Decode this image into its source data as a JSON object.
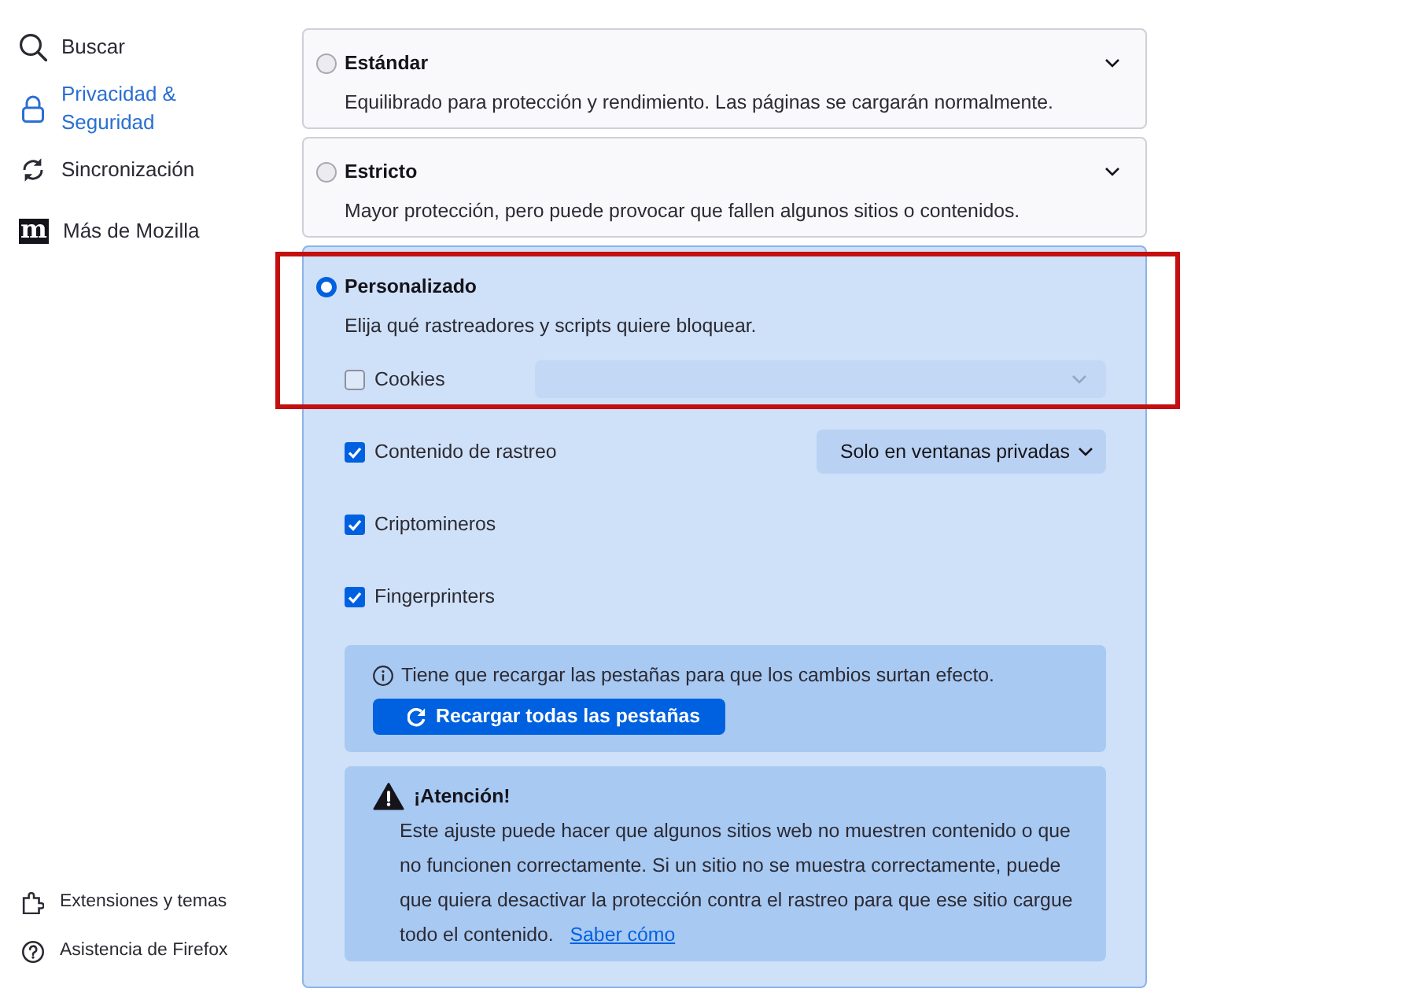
{
  "sidebar": {
    "items": [
      {
        "label": "Buscar",
        "selected": false
      },
      {
        "label": "Privacidad & Seguridad",
        "selected": true
      },
      {
        "label": "Sincronización",
        "selected": false
      },
      {
        "label": "Más de Mozilla",
        "selected": false,
        "logo_glyph": "m"
      }
    ],
    "footer_links": [
      {
        "label": "Extensiones y temas"
      },
      {
        "label": "Asistencia de Firefox"
      }
    ]
  },
  "protection_levels": [
    {
      "label": "Estándar",
      "description": "Equilibrado para protección y rendimiento. Las páginas se cargarán normalmente.",
      "selected": false,
      "expanded": false
    },
    {
      "label": "Estricto",
      "description": "Mayor protección, pero puede provocar que fallen algunos sitios o contenidos.",
      "selected": false,
      "expanded": false
    },
    {
      "label": "Personalizado",
      "description": "Elija qué rastreadores y scripts quiere bloquear.",
      "selected": true,
      "expanded": true,
      "highlighted": true,
      "options": [
        {
          "label": "Cookies",
          "checked": false,
          "dropdown": {
            "disabled": true
          }
        },
        {
          "label": "Contenido de rastreo",
          "checked": true,
          "dropdown": {
            "value": "Solo en ventanas privadas",
            "disabled": false
          }
        },
        {
          "label": "Criptomineros",
          "checked": true
        },
        {
          "label": "Fingerprinters",
          "checked": true
        }
      ],
      "notice": {
        "text": "Tiene que recargar las pestañas para que los cambios surtan efecto.",
        "button": "Recargar todas las pestañas"
      },
      "warning": {
        "title": "¡Atención!",
        "text": "Este ajuste puede hacer que algunos sitios web no muestren contenido o que no funcionen correctamente. Si un sitio no se muestra correctamente, puede que quiera desactivar la protección contra el rastreo para que ese sitio cargue todo el contenido.",
        "link": "Saber cómo"
      }
    }
  ]
}
